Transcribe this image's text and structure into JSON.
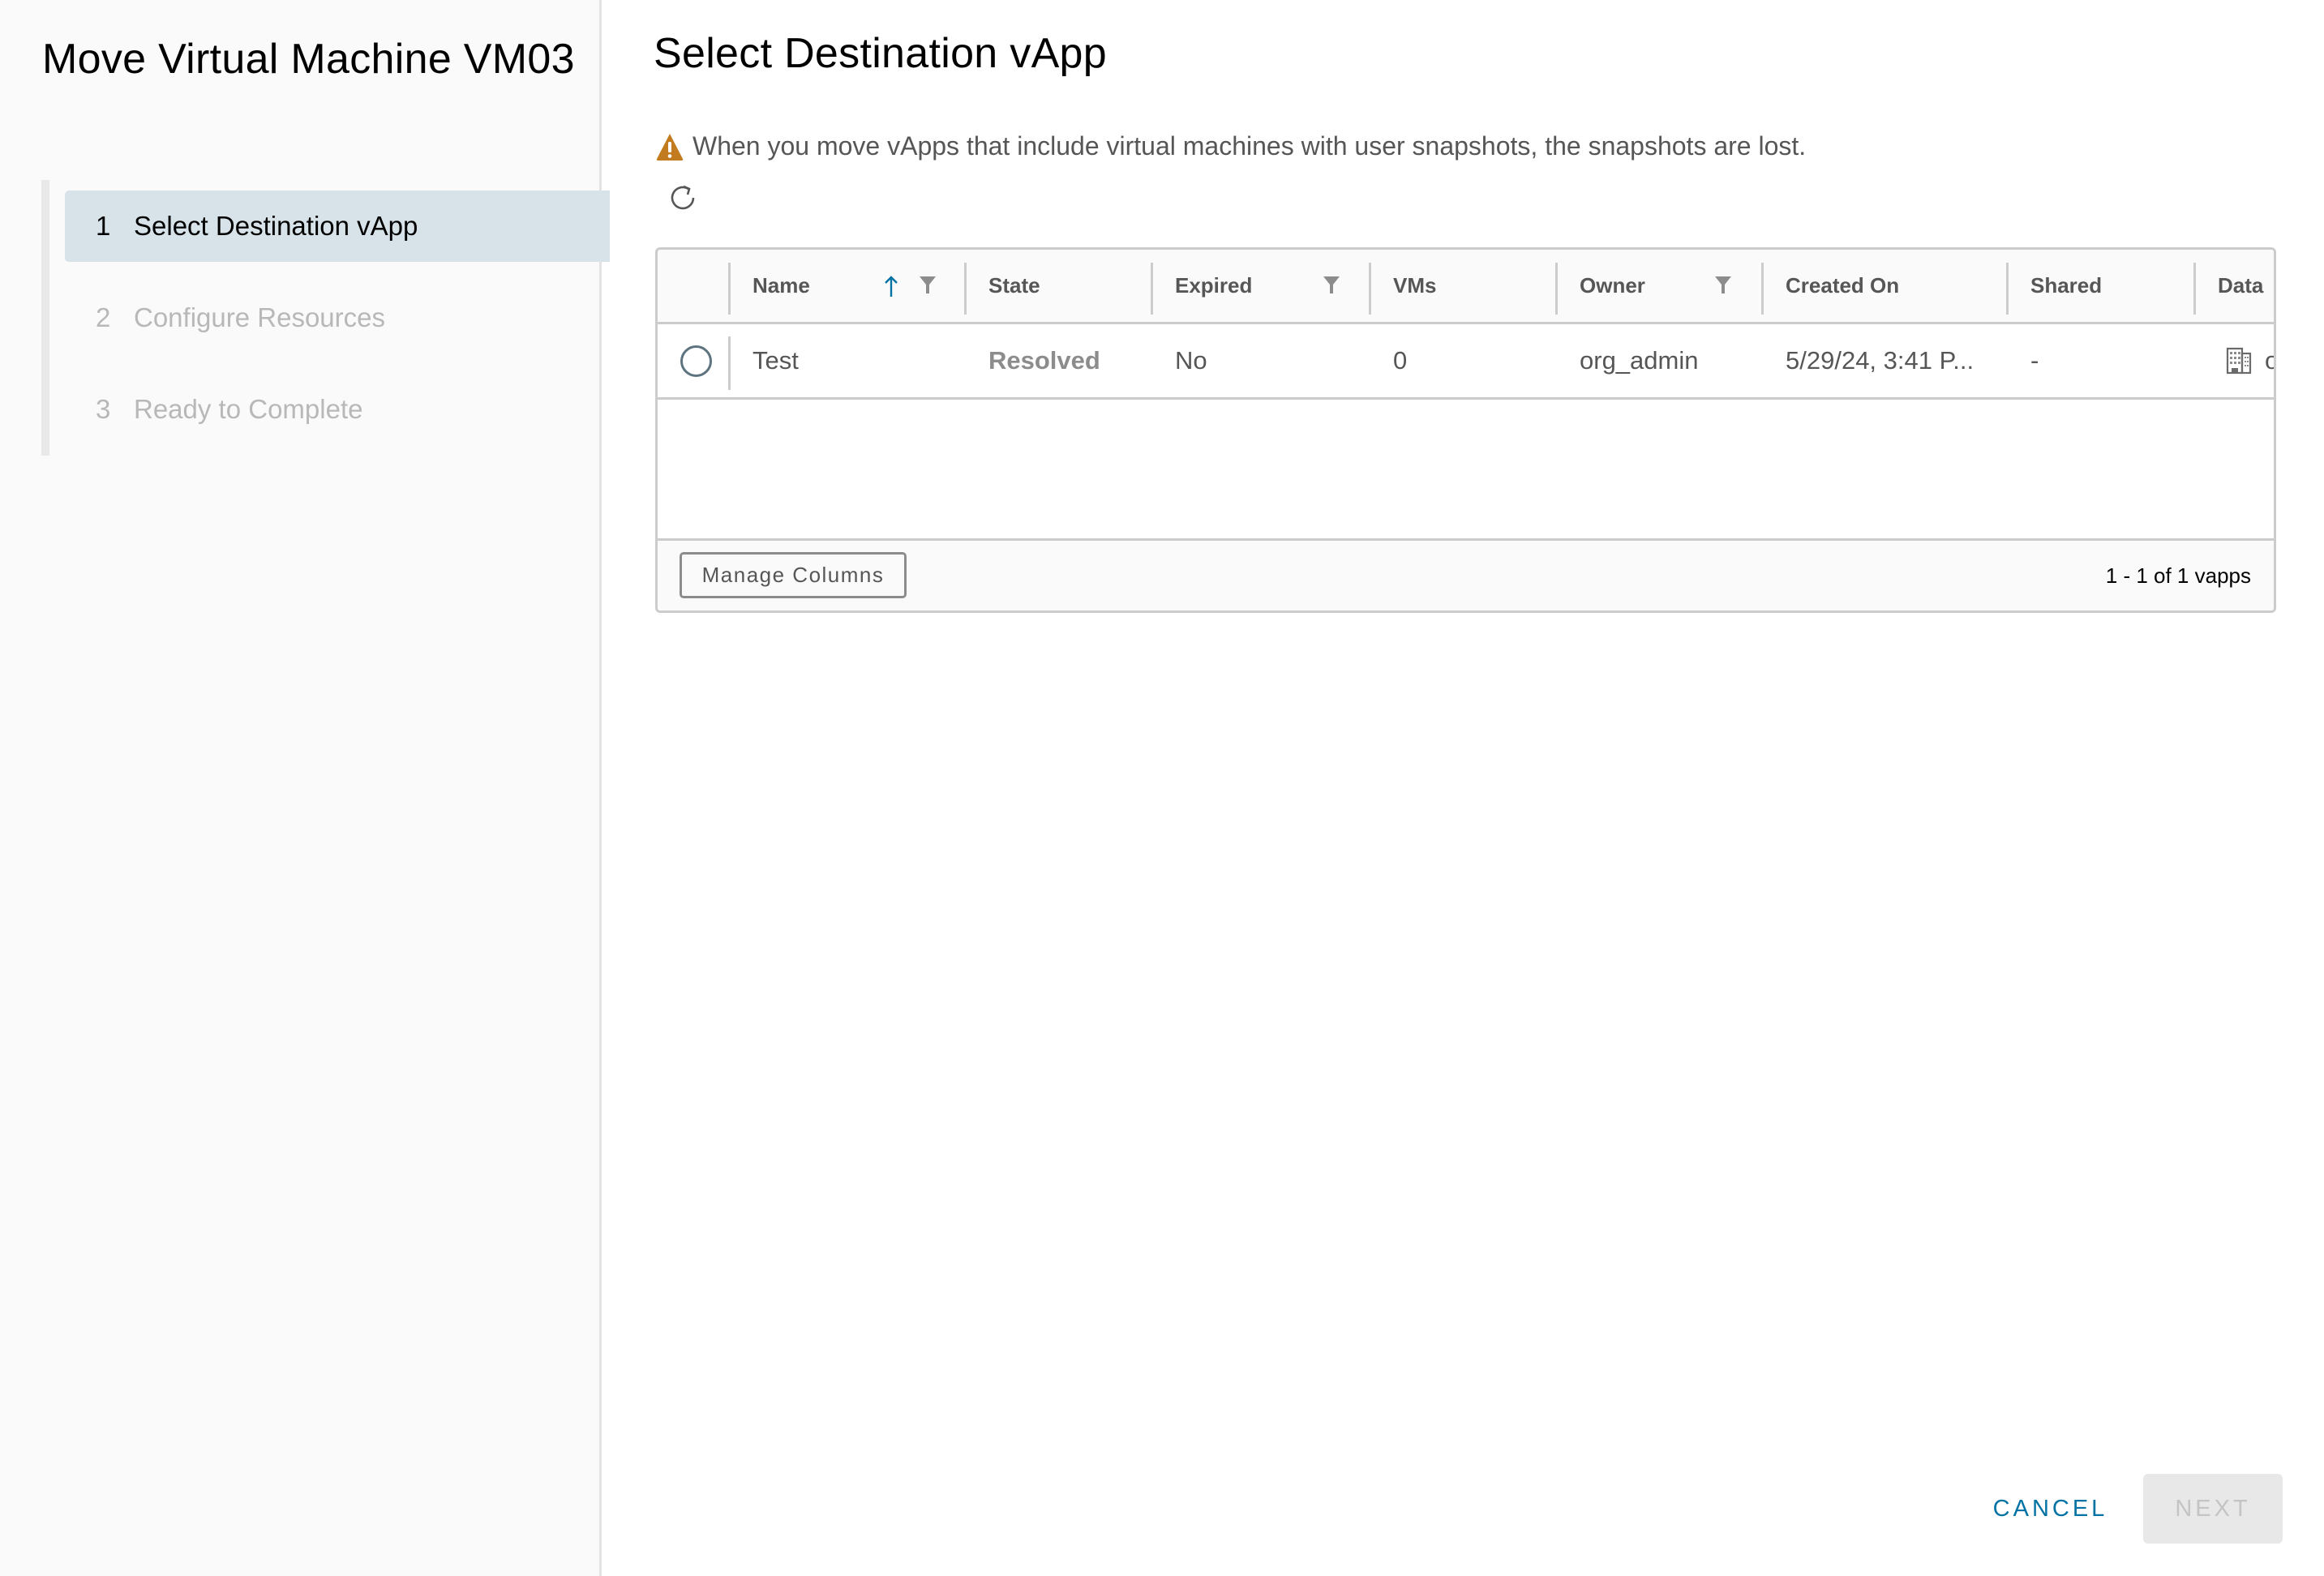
{
  "sidebar": {
    "title": "Move Virtual Machine VM03",
    "steps": [
      {
        "number": "1",
        "label": "Select Destination vApp",
        "state": "active"
      },
      {
        "number": "2",
        "label": "Configure Resources",
        "state": "disabled"
      },
      {
        "number": "3",
        "label": "Ready to Complete",
        "state": "disabled"
      }
    ]
  },
  "main": {
    "title": "Select Destination vApp",
    "warning": {
      "icon": "warning-triangle-icon",
      "text": "When you move vApps that include virtual machines with user snapshots, the snapshots are lost.",
      "color": "#c27b1f"
    },
    "refresh_icon": "refresh-icon"
  },
  "grid": {
    "columns": [
      {
        "label": "Name",
        "sortable": true,
        "sort": "ascending",
        "filterable": true
      },
      {
        "label": "State",
        "filterable": false
      },
      {
        "label": "Expired",
        "filterable": true
      },
      {
        "label": "VMs",
        "filterable": false
      },
      {
        "label": "Owner",
        "filterable": true
      },
      {
        "label": "Created On",
        "filterable": false
      },
      {
        "label": "Shared",
        "filterable": false
      },
      {
        "label": "Data",
        "filterable": false
      }
    ],
    "rows": [
      {
        "selected": false,
        "name": "Test",
        "state": "Resolved",
        "expired": "No",
        "vms": "0",
        "owner": "org_admin",
        "created_on": "5/29/24, 3:41 P...",
        "shared": "-",
        "data_icon": "building-icon",
        "data": "o"
      }
    ],
    "footer": {
      "manage_columns_label": "Manage Columns",
      "pagination": "1 - 1 of 1 vapps"
    }
  },
  "actions": {
    "cancel_label": "CANCEL",
    "next_label": "NEXT",
    "next_enabled": false
  },
  "colors": {
    "accent": "#0072a3",
    "active_step_bg": "#d8e3e9",
    "disabled_text": "#b8b8b8",
    "warning": "#c27b1f"
  }
}
